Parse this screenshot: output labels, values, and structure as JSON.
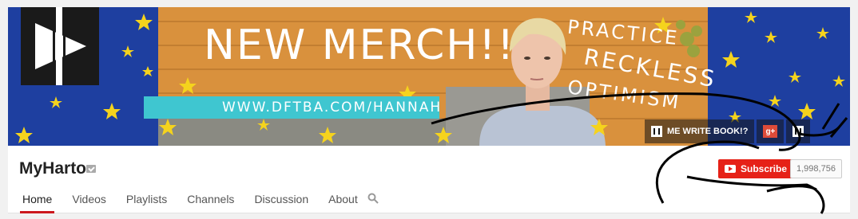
{
  "banner": {
    "headline": "NEW MERCH!!",
    "url": "WWW.DFTBA.COM/HANNAH",
    "slogan": [
      "PRACTICE",
      "RECKLESS",
      "OPTIMISM"
    ],
    "colors": {
      "sky": "#1e3fa0",
      "wood": "#d9913d",
      "accent": "#3fc6d0",
      "star": "#f5d31d"
    }
  },
  "banner_links": [
    {
      "label": "ME WRITE BOOK!?",
      "icon": "h-logo-icon"
    },
    {
      "label": "g+",
      "icon": "google-plus-icon"
    },
    {
      "label": "",
      "icon": "h-logo-icon"
    }
  ],
  "channel": {
    "name": "MyHarto",
    "verified_icon": "verified-badge-icon"
  },
  "tabs": [
    {
      "label": "Home",
      "active": true
    },
    {
      "label": "Videos"
    },
    {
      "label": "Playlists"
    },
    {
      "label": "Channels"
    },
    {
      "label": "Discussion"
    },
    {
      "label": "About"
    }
  ],
  "subscribe": {
    "label": "Subscribe",
    "count": "1,998,756",
    "color": "#e62117"
  }
}
